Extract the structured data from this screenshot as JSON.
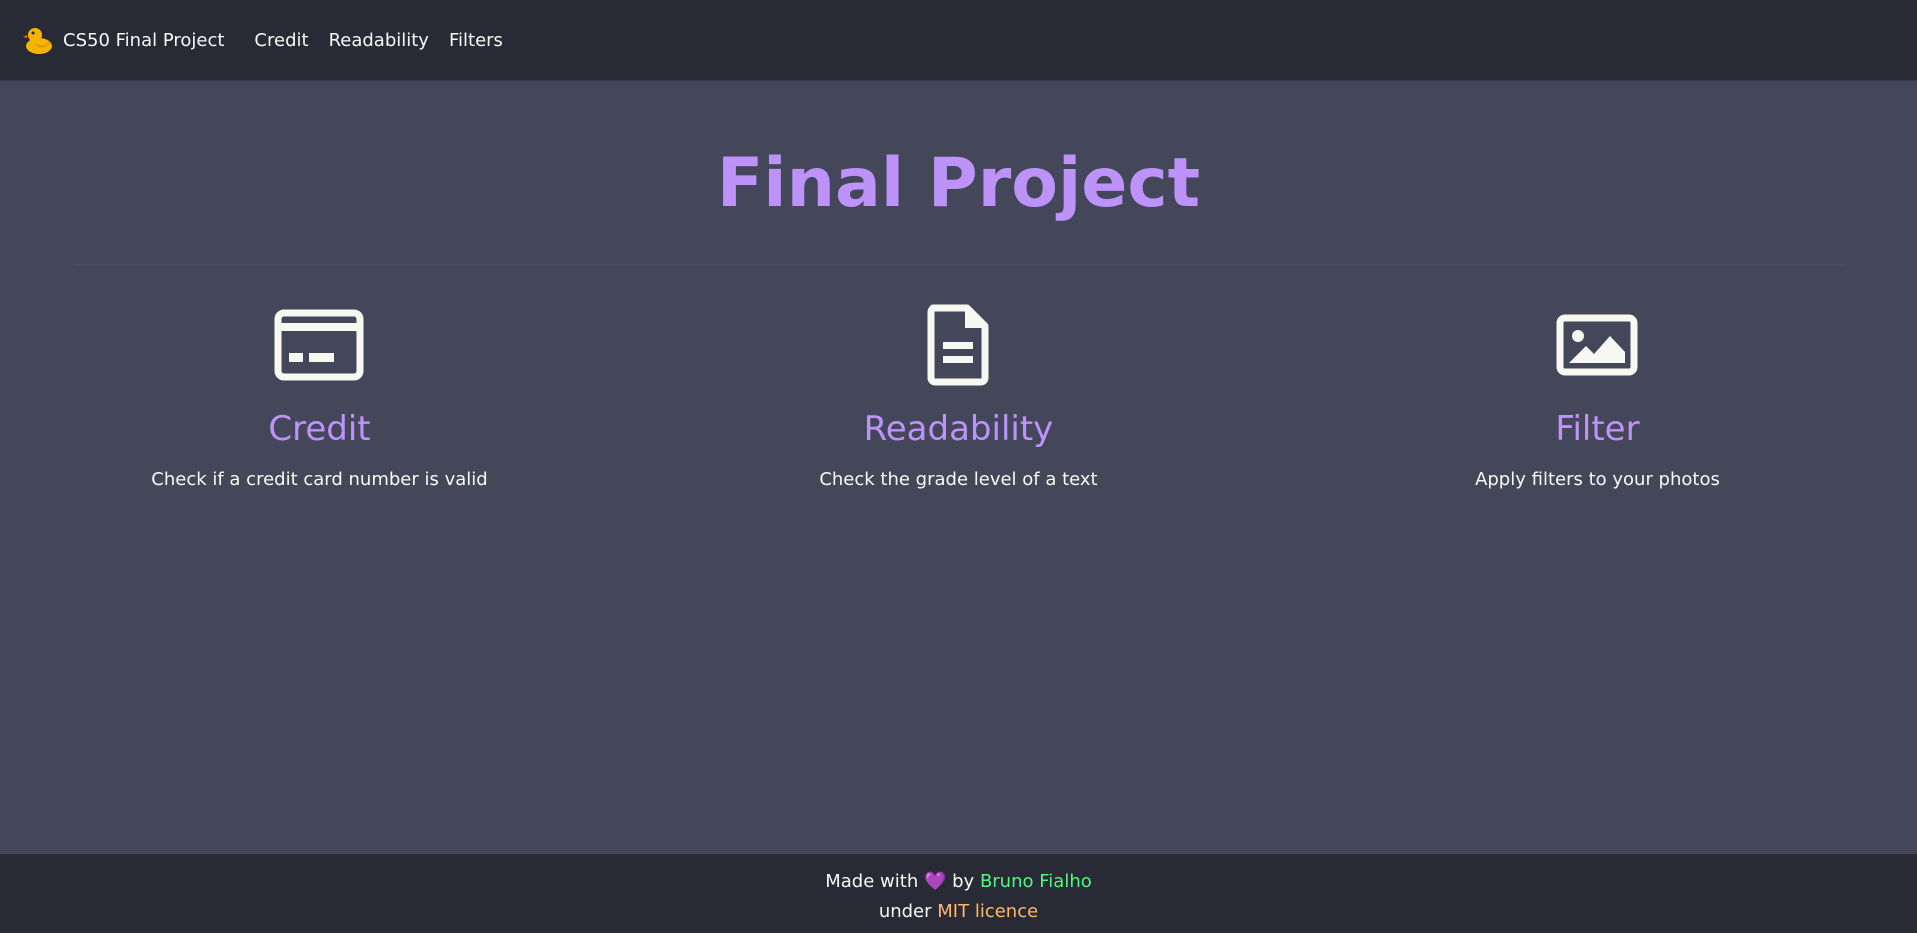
{
  "nav": {
    "brand": "CS50 Final Project",
    "brand_icon": "duck-icon",
    "links": [
      "Credit",
      "Readability",
      "Filters"
    ]
  },
  "main": {
    "title": "Final Project",
    "cards": [
      {
        "icon": "credit-card-icon",
        "title": "Credit",
        "description": "Check if a credit card number is valid"
      },
      {
        "icon": "document-icon",
        "title": "Readability",
        "description": "Check the grade level of a text"
      },
      {
        "icon": "image-icon",
        "title": "Filter",
        "description": "Apply filters to your photos"
      }
    ]
  },
  "footer": {
    "made_with": "Made with",
    "heart": "💜",
    "by": "by",
    "author": "Bruno Fialho",
    "under": "under",
    "licence": "MIT licence"
  },
  "colors": {
    "background": "#44475a",
    "bar": "#282a36",
    "accent": "#bd93f9",
    "text": "#f8f8f2",
    "author": "#50fa7b",
    "licence": "#ffb86c"
  }
}
